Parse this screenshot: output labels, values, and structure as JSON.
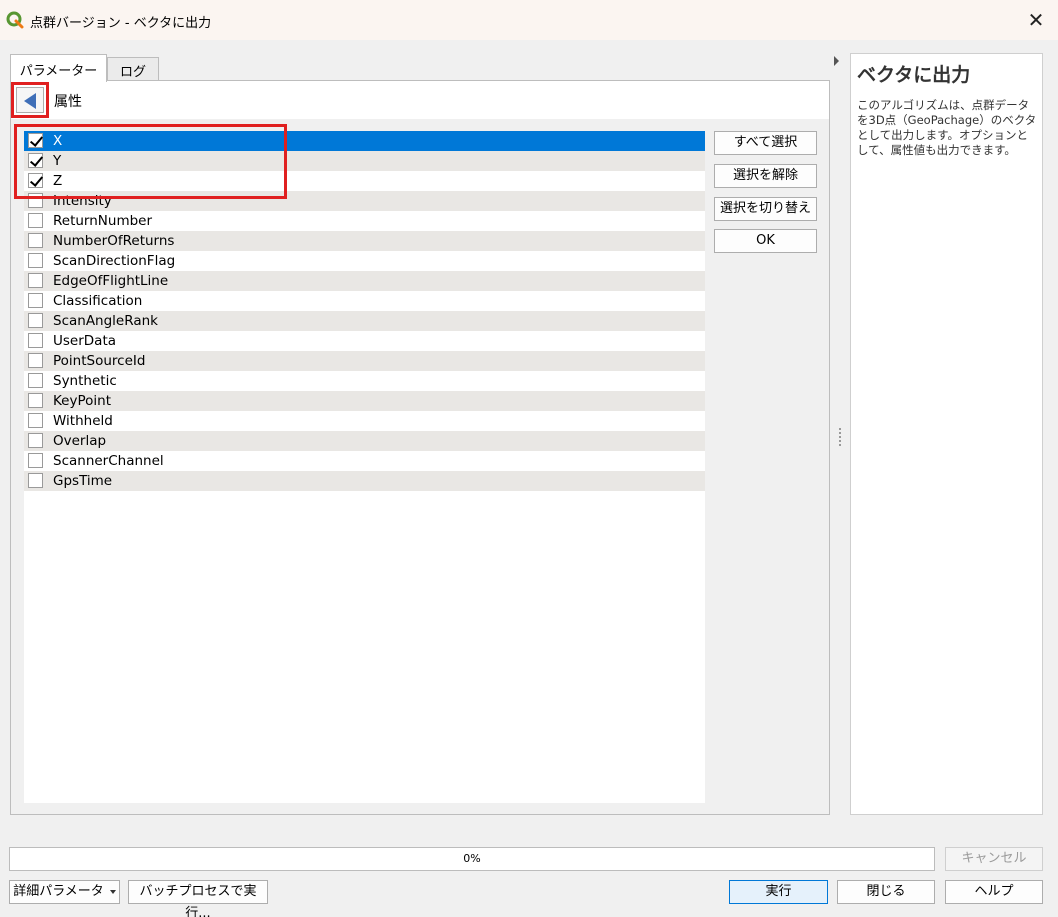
{
  "window": {
    "title": "点群バージョン - ベクタに出力",
    "close_label": "✕"
  },
  "tabs": [
    {
      "label": "パラメーター",
      "active": true
    },
    {
      "label": "ログ",
      "active": false
    }
  ],
  "panel": {
    "header_label": "属性"
  },
  "fields": [
    {
      "label": "X",
      "checked": true,
      "selected": true
    },
    {
      "label": "Y",
      "checked": true,
      "selected": false
    },
    {
      "label": "Z",
      "checked": true,
      "selected": false
    },
    {
      "label": "Intensity",
      "checked": false,
      "selected": false
    },
    {
      "label": "ReturnNumber",
      "checked": false,
      "selected": false
    },
    {
      "label": "NumberOfReturns",
      "checked": false,
      "selected": false
    },
    {
      "label": "ScanDirectionFlag",
      "checked": false,
      "selected": false
    },
    {
      "label": "EdgeOfFlightLine",
      "checked": false,
      "selected": false
    },
    {
      "label": "Classification",
      "checked": false,
      "selected": false
    },
    {
      "label": "ScanAngleRank",
      "checked": false,
      "selected": false
    },
    {
      "label": "UserData",
      "checked": false,
      "selected": false
    },
    {
      "label": "PointSourceId",
      "checked": false,
      "selected": false
    },
    {
      "label": "Synthetic",
      "checked": false,
      "selected": false
    },
    {
      "label": "KeyPoint",
      "checked": false,
      "selected": false
    },
    {
      "label": "Withheld",
      "checked": false,
      "selected": false
    },
    {
      "label": "Overlap",
      "checked": false,
      "selected": false
    },
    {
      "label": "ScannerChannel",
      "checked": false,
      "selected": false
    },
    {
      "label": "GpsTime",
      "checked": false,
      "selected": false
    }
  ],
  "side_buttons": {
    "select_all": "すべて選択",
    "deselect": "選択を解除",
    "toggle": "選択を切り替え",
    "ok": "OK"
  },
  "help": {
    "title": "ベクタに出力",
    "body": "このアルゴリズムは、点群データを3D点（GeoPachage）のベクタとして出力します。オプションとして、属性値も出力できます。"
  },
  "progress": {
    "value": 0,
    "text": "0%"
  },
  "bottom": {
    "cancel": "キャンセル",
    "advanced": "詳細パラメータ",
    "batch": "バッチプロセスで実行...",
    "run": "実行",
    "close": "閉じる",
    "help": "ヘルプ"
  },
  "colors": {
    "selection": "#0078d7",
    "highlight": "#e02020",
    "qgis_green": "#589632"
  }
}
